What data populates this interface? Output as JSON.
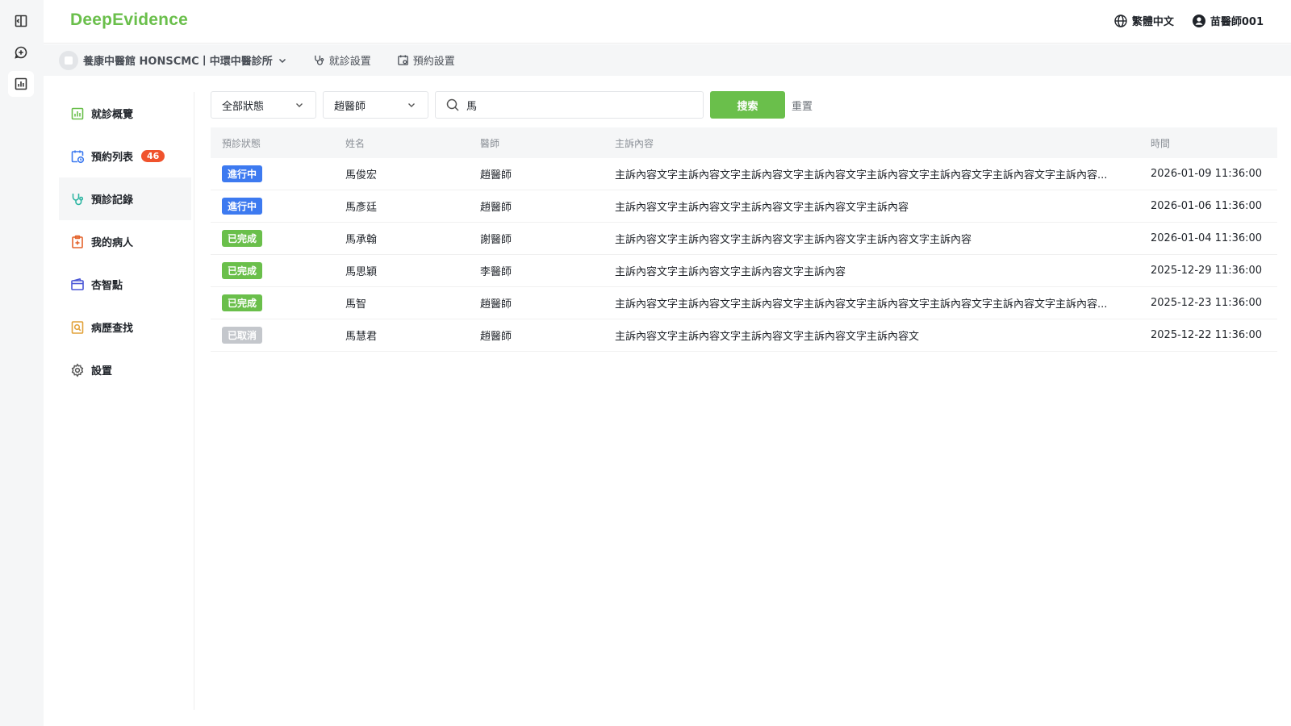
{
  "app": {
    "logo": "DeepEvidence"
  },
  "topbar": {
    "language": "繁體中文",
    "user": "苗醫師001"
  },
  "subbar": {
    "org": "養康中醫館 HONSCMC丨中環中醫診所",
    "visit_settings": "就診設置",
    "booking_settings": "預約設置"
  },
  "sidebar": {
    "items": [
      {
        "label": "就診概覽",
        "icon": "chart-icon",
        "color": "#6abf4b"
      },
      {
        "label": "預約列表",
        "icon": "calendar-clock-icon",
        "color": "#3d7af0",
        "badge": "46"
      },
      {
        "label": "預診記錄",
        "icon": "stethoscope-icon",
        "color": "#2fb6a3"
      },
      {
        "label": "我的病人",
        "icon": "patient-clipboard-icon",
        "color": "#e4632c"
      },
      {
        "label": "杏智點",
        "icon": "wallet-icon",
        "color": "#4a56d6"
      },
      {
        "label": "病歷查找",
        "icon": "record-search-icon",
        "color": "#e2a23a"
      },
      {
        "label": "設置",
        "icon": "gear-icon",
        "color": "#555555"
      }
    ]
  },
  "filters": {
    "status_value": "全部狀態",
    "doctor_value": "趙醫師",
    "search_value": "馬",
    "search_label": "搜索",
    "reset_label": "重置"
  },
  "table": {
    "headers": {
      "status": "預診狀態",
      "name": "姓名",
      "doctor": "醫師",
      "content": "主訴內容",
      "time": "時間"
    },
    "rows": [
      {
        "status": "進行中",
        "status_color": "#3d7af0",
        "name": "馬俊宏",
        "doctor": "趙醫師",
        "content": "主訴內容文字主訴內容文字主訴內容文字主訴內容文字主訴內容文字主訴內容文字主訴內容文字主訴內容...",
        "time": "2026-01-09 11:36:00"
      },
      {
        "status": "進行中",
        "status_color": "#3d7af0",
        "name": "馬彥廷",
        "doctor": "趙醫師",
        "content": "主訴內容文字主訴內容文字主訴內容文字主訴內容文字主訴內容",
        "time": "2026-01-06 11:36:00"
      },
      {
        "status": "已完成",
        "status_color": "#6abf4b",
        "name": "馬承翰",
        "doctor": "謝醫師",
        "content": "主訴內容文字主訴內容文字主訴內容文字主訴內容文字主訴內容文字主訴內容",
        "time": "2026-01-04 11:36:00"
      },
      {
        "status": "已完成",
        "status_color": "#6abf4b",
        "name": "馬思穎",
        "doctor": "李醫師",
        "content": "主訴內容文字主訴內容文字主訴內容文字主訴內容",
        "time": "2025-12-29 11:36:00"
      },
      {
        "status": "已完成",
        "status_color": "#6abf4b",
        "name": "馬智",
        "doctor": "趙醫師",
        "content": "主訴內容文字主訴內容文字主訴內容文字主訴內容文字主訴內容文字主訴內容文字主訴內容文字主訴內容...",
        "time": "2025-12-23 11:36:00"
      },
      {
        "status": "已取消",
        "status_color": "#c4c7cc",
        "name": "馬慧君",
        "doctor": "趙醫師",
        "content": "主訴內容文字主訴內容文字主訴內容文字主訴內容文字主訴內容文",
        "time": "2025-12-22 11:36:00"
      }
    ]
  }
}
